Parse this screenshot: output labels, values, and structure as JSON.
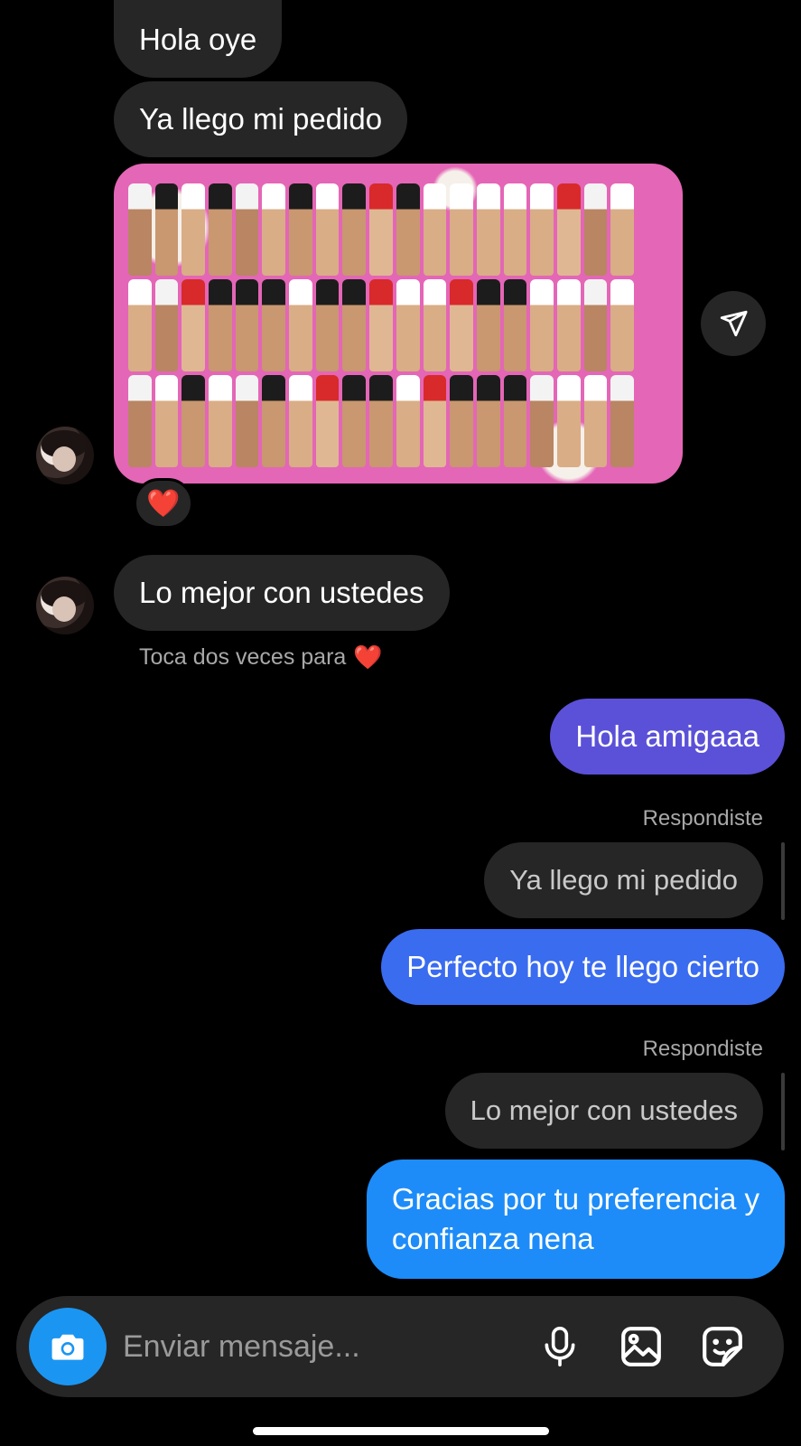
{
  "theme": {
    "bg": "#000000",
    "incoming_bubble": "#262626",
    "outgoing_1": "#5b51d8",
    "outgoing_2": "#3a6cf0",
    "outgoing_3": "#1d8cf8",
    "camera_button": "#1b95f2"
  },
  "messages": [
    {
      "id": "m1",
      "direction": "in",
      "text": "Hola oye"
    },
    {
      "id": "m2",
      "direction": "in",
      "text": "Ya llego mi pedido"
    },
    {
      "id": "m3",
      "direction": "in",
      "type": "photo",
      "reaction": "❤️",
      "photo_icon": "send-paper-plane-icon"
    },
    {
      "id": "m4",
      "direction": "in",
      "text": "Lo mejor con ustedes",
      "hint": "Toca dos veces para",
      "hint_emoji": "❤️"
    },
    {
      "id": "m5",
      "direction": "out",
      "text": "Hola amigaaa"
    },
    {
      "id": "m6",
      "direction": "out",
      "reply_label": "Respondiste",
      "quoted": "Ya llego mi pedido",
      "text": "Perfecto hoy te llego cierto"
    },
    {
      "id": "m7",
      "direction": "out",
      "reply_label": "Respondiste",
      "quoted": "Lo mejor con ustedes",
      "text_line1": "Gracias por tu preferencia y",
      "text_line2": "confianza nena"
    }
  ],
  "composer": {
    "placeholder": "Enviar mensaje...",
    "icons": [
      "camera-icon",
      "microphone-icon",
      "gallery-icon",
      "sticker-icon"
    ]
  }
}
